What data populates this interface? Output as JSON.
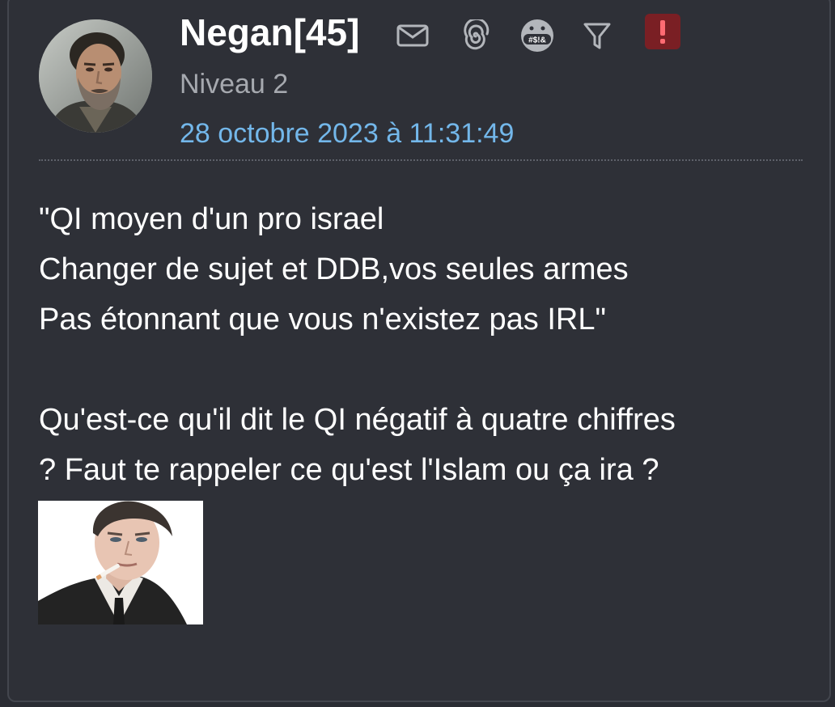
{
  "colors": {
    "page_background": "#2a2c33",
    "card_background": "#2e3037",
    "username": "#ffffff",
    "level_text": "#a6a9af",
    "date_link": "#73b7ea",
    "body_text": "#ffffff",
    "alert_badge": "#7a1f24"
  },
  "author": {
    "username": "Negan[45]",
    "level": "Niveau 2",
    "avatar_icon": "user-avatar-photo"
  },
  "header_icons": [
    {
      "name": "envelope-icon",
      "action": "send private message"
    },
    {
      "name": "spiral-icon",
      "action": "follow"
    },
    {
      "name": "censored-emoji-icon",
      "action": "blacklist"
    },
    {
      "name": "funnel-icon",
      "action": "filter messages"
    },
    {
      "name": "exclamation-icon",
      "action": "report"
    }
  ],
  "post": {
    "date": "28 octobre 2023 à 11:31:49",
    "quote_lines": [
      "\"QI moyen d'un pro israel",
      "Changer de sujet et DDB,vos seules armes",
      "Pas étonnant que vous n'existez pas IRL\""
    ],
    "reply_lines": [
      "Qu'est-ce qu'il dit le QI négatif à quatre chiffres",
      "? Faut te rappeler ce qu'est l'Islam ou ça ira ?"
    ],
    "image_icon": "embedded-meme-image"
  }
}
